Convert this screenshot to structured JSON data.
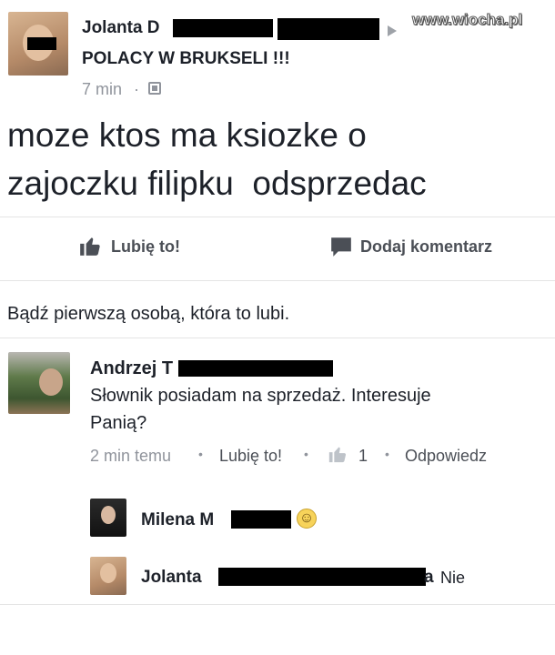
{
  "post": {
    "author_name": "Jolanta D",
    "group_name": "POLACY W BRUKSELI !!!",
    "time": "7 min",
    "dot": "·",
    "text_line1": "moze ktos ma ksiozke o",
    "text_line2": "zajoczku filipku  odsprzedac"
  },
  "watermark": "www.wiocha.pl",
  "actions": {
    "like_label": "Lubię to!",
    "comment_label": "Dodaj komentarz"
  },
  "likes_summary": "Bądź pierwszą osobą, która to lubi.",
  "comments": [
    {
      "author": "Andrzej T",
      "text_line1": "Słownik posiadam na sprzedaż. Interesuje",
      "text_line2": "Panią?",
      "time": "2 min temu",
      "like_label": "Lubię to!",
      "like_count": "1",
      "reply_label": "Odpowiedz",
      "sep": "•"
    }
  ],
  "replies": [
    {
      "author": "Milena M",
      "emoji": "☺"
    },
    {
      "author": "Jolanta",
      "author_suffix": "a",
      "text": "Nie"
    }
  ],
  "colors": {
    "accent": "#4b4f56",
    "meta": "#90949c",
    "text": "#1d2129"
  },
  "icons": [
    "thumbs-up-icon",
    "comment-bubble-icon",
    "globe-icon",
    "chevron-right-icon",
    "smiley-icon"
  ]
}
